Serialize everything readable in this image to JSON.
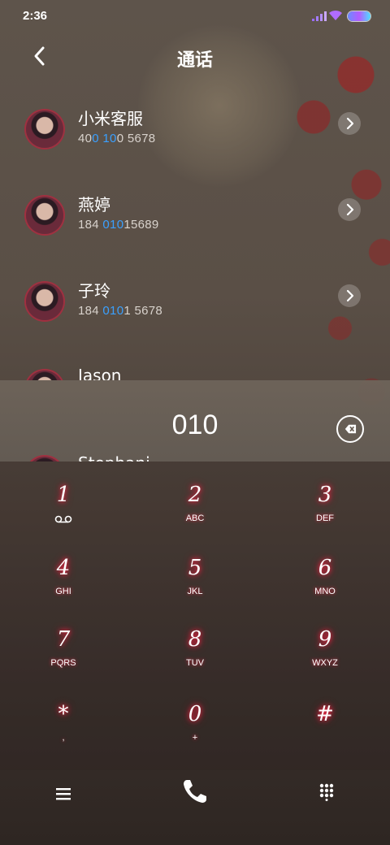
{
  "status": {
    "time": "2:36"
  },
  "header": {
    "title": "通话"
  },
  "contacts": [
    {
      "name": "小米客服",
      "number_parts": [
        "40",
        "0 10",
        "0 5678"
      ]
    },
    {
      "name": "燕婷",
      "number_parts": [
        "184 ",
        "010",
        "15689"
      ]
    },
    {
      "name": "子玲",
      "number_parts": [
        "184 ",
        "010",
        "1 5678"
      ]
    },
    {
      "name": "Jason"
    },
    {
      "name": "Stephani"
    }
  ],
  "dialer": {
    "input": "010"
  },
  "keys": [
    {
      "num": "1",
      "sub": "voicemail-icon"
    },
    {
      "num": "2",
      "sub": "ABC"
    },
    {
      "num": "3",
      "sub": "DEF"
    },
    {
      "num": "4",
      "sub": "GHI"
    },
    {
      "num": "5",
      "sub": "JKL"
    },
    {
      "num": "6",
      "sub": "MNO"
    },
    {
      "num": "7",
      "sub": "PQRS"
    },
    {
      "num": "8",
      "sub": "TUV"
    },
    {
      "num": "9",
      "sub": "WXYZ"
    },
    {
      "num": "*",
      "sub": ","
    },
    {
      "num": "0",
      "sub": "+"
    },
    {
      "num": "#",
      "sub": ""
    }
  ],
  "colors": {
    "highlight": "#3aa0ff",
    "key_glow": "#ff2a4a"
  },
  "icons": {
    "back": "chevron-left-icon",
    "arrow": "chevron-right-icon",
    "delete": "backspace-icon",
    "menu": "hamburger-icon",
    "call": "phone-icon",
    "keypad": "dialpad-icon"
  }
}
